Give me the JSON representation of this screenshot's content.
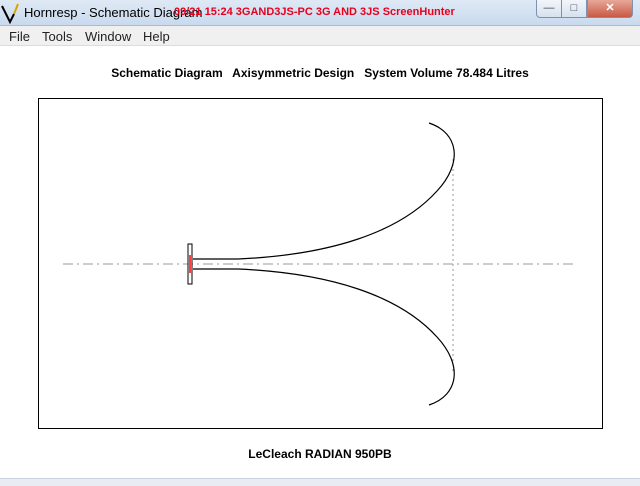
{
  "window": {
    "title": "Hornresp - Schematic Diagram",
    "overlay_text": "09/21  15:24  3GAND3JS-PC  3G AND 3JS  ScreenHunter"
  },
  "menu": [
    "File",
    "Tools",
    "Window",
    "Help"
  ],
  "heading": "Schematic Diagram   Axisymmetric Design   System Volume 78.484 Litres",
  "footer": "LeCleach RADIAN 950PB",
  "colors": {
    "overlay_red": "#e8001c",
    "driver_red": "#ff0000",
    "guide_gray": "#999999"
  },
  "icons": {
    "app": "hornresp-app-icon",
    "minimize": "minimize-icon",
    "maximize": "maximize-icon",
    "close": "close-icon"
  }
}
